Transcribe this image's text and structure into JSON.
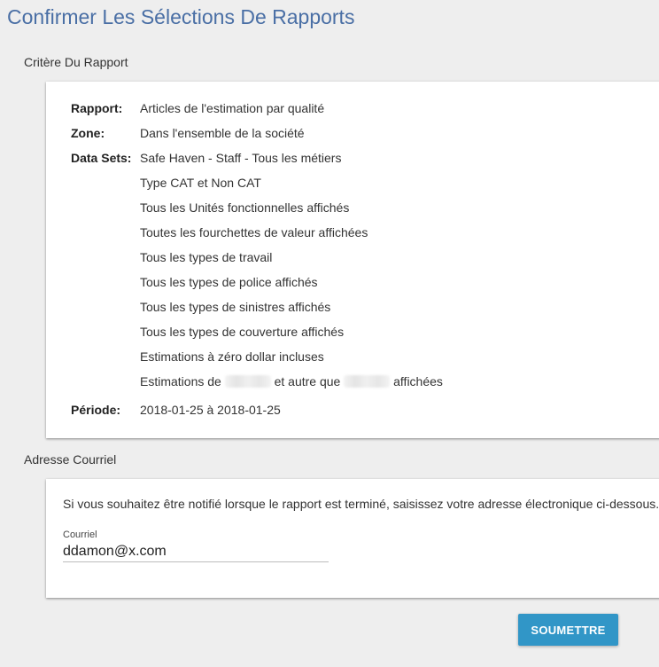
{
  "page": {
    "title": "Confirmer Les Sélections De Rapports"
  },
  "criteria": {
    "section_label": "Critère Du Rapport",
    "report_key": "Rapport:",
    "report_value": "Articles de l'estimation par qualité",
    "zone_key": "Zone:",
    "zone_value": "Dans l'ensemble de la société",
    "datasets_key": "Data Sets:",
    "datasets": [
      "Safe Haven - Staff - Tous les métiers",
      "Type CAT et Non CAT",
      "Tous les Unités fonctionnelles affichés",
      "Toutes les fourchettes de valeur affichées",
      "Tous les types de travail",
      "Tous les types de police affichés",
      "Tous les types de sinistres affichés",
      "Tous les types de couverture affichés",
      "Estimations à zéro dollar incluses"
    ],
    "last_dataset": {
      "part1": "Estimations de",
      "part2": "et autre que",
      "part3": "affichées"
    },
    "period_key": "Période:",
    "period_value": "2018-01-25 à 2018-01-25"
  },
  "email": {
    "section_label": "Adresse Courriel",
    "description": "Si vous souhaitez être notifié lorsque le rapport est terminé, saisissez votre adresse électronique ci-dessous.",
    "field_label": "Courriel",
    "field_value": "ddamon@x.com"
  },
  "actions": {
    "submit_label": "SOUMETTRE"
  }
}
